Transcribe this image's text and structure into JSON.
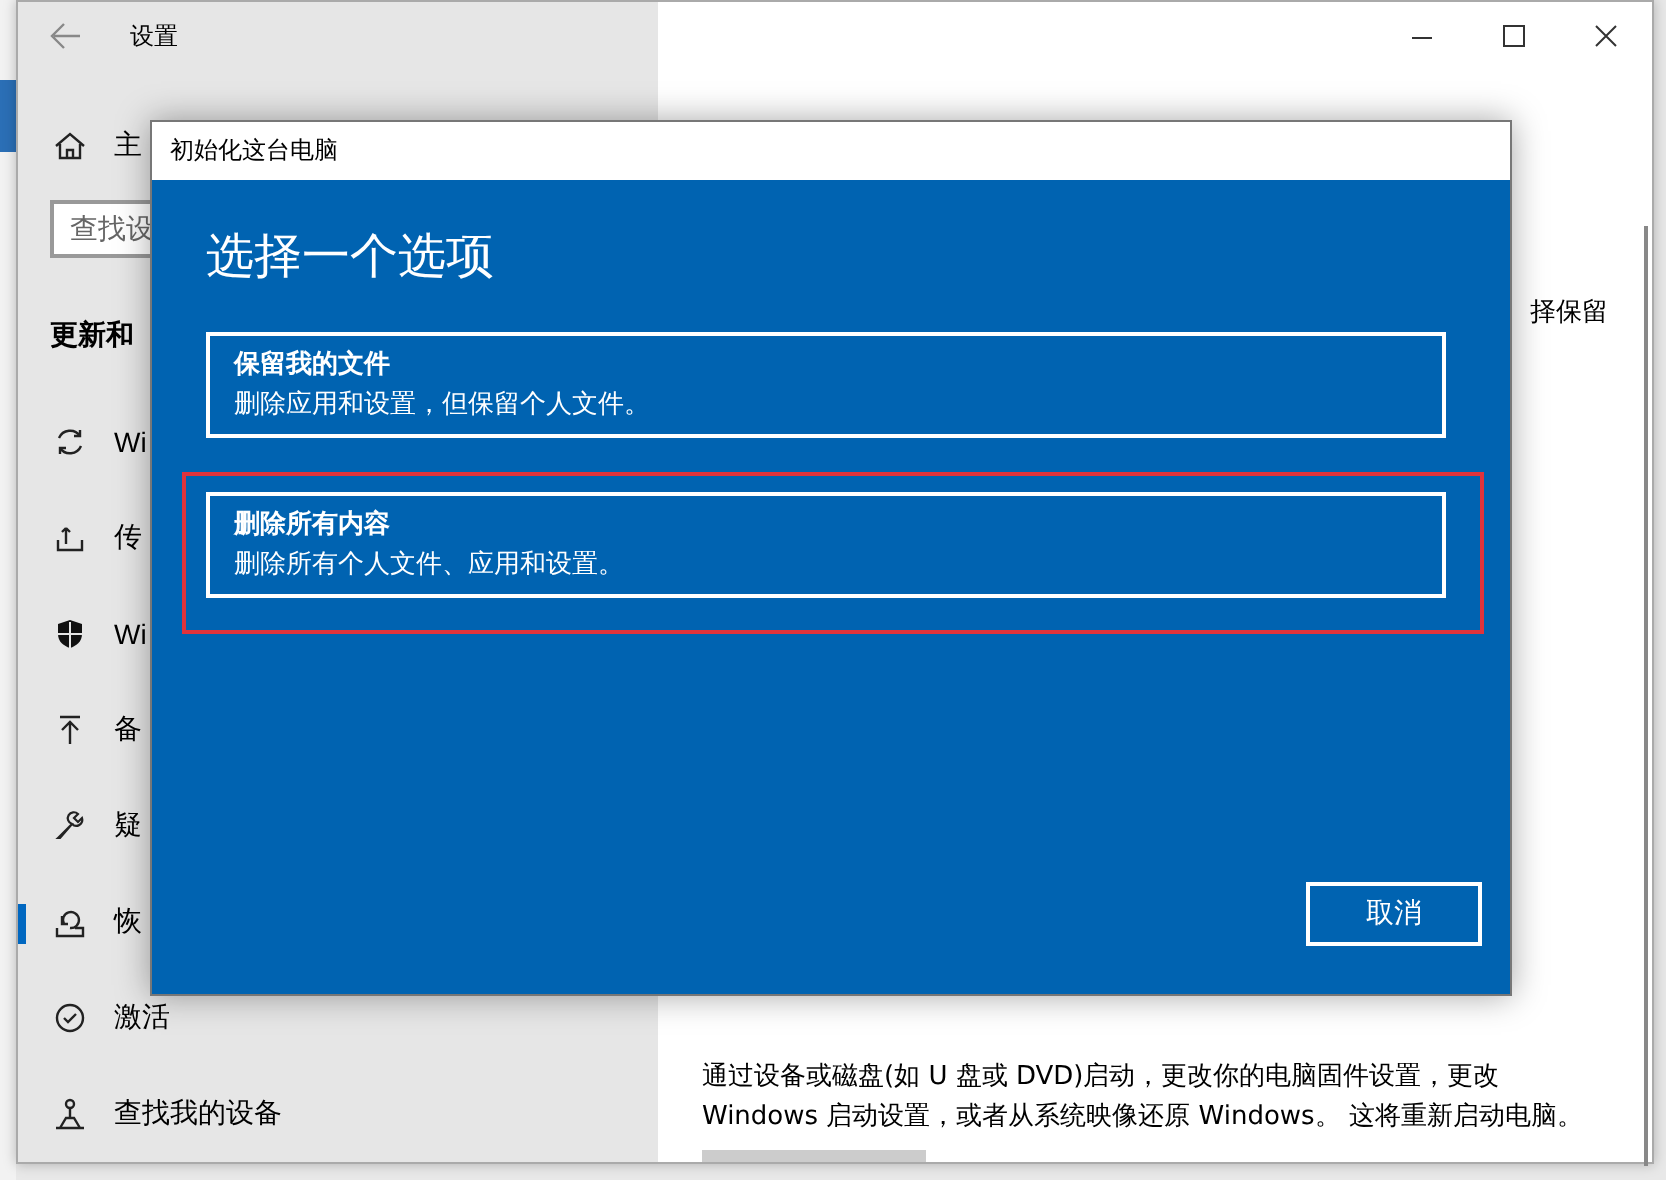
{
  "window": {
    "title": "设置"
  },
  "sidebar": {
    "home": "主",
    "search": {
      "placeholder": "查找设"
    },
    "section": "更新和",
    "items": [
      {
        "label": "Wi",
        "selected": false
      },
      {
        "label": "传",
        "selected": false
      },
      {
        "label": "Wi",
        "selected": false
      },
      {
        "label": "备",
        "selected": false
      },
      {
        "label": "疑",
        "selected": false
      },
      {
        "label": "恢",
        "selected": true
      },
      {
        "label": "激活",
        "selected": false
      },
      {
        "label": "查找我的设备",
        "selected": false
      }
    ]
  },
  "content": {
    "fragment": "择保留",
    "description": "通过设备或磁盘(如 U 盘或 DVD)启动，更改你的电脑固件设置，更改 Windows 启动设置，或者从系统映像还原 Windows。 这将重新启动电脑。"
  },
  "dialog": {
    "title": "初始化这台电脑",
    "heading": "选择一个选项",
    "options": [
      {
        "title": "保留我的文件",
        "description": "删除应用和设置，但保留个人文件。",
        "highlighted": false
      },
      {
        "title": "删除所有内容",
        "description": "删除所有个人文件、应用和设置。",
        "highlighted": true
      }
    ],
    "cancel": "取消"
  }
}
